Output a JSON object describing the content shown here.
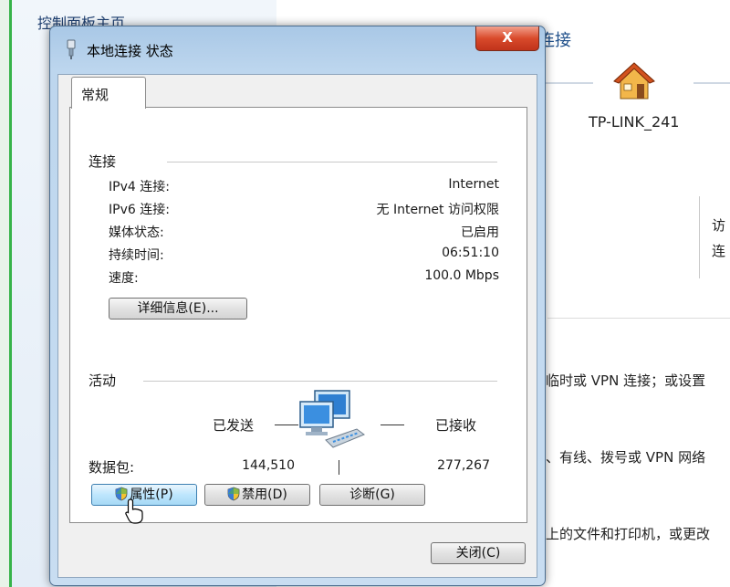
{
  "background": {
    "nav_title": "控制面板主页",
    "connection_title": "连接",
    "network_name": "TP-LINK_241",
    "access_labels": [
      "访",
      "连"
    ],
    "text_lines": [
      "临时或 VPN 连接；或设置",
      "、有线、拨号或 VPN 网络",
      "上的文件和打印机，或更改"
    ]
  },
  "dialog": {
    "title": "本地连接 状态",
    "close_label": "X",
    "tab_label": "常规",
    "connection": {
      "heading": "连接",
      "rows": [
        {
          "label": "IPv4 连接:",
          "value": "Internet"
        },
        {
          "label": "IPv6 连接:",
          "value": "无 Internet 访问权限"
        },
        {
          "label": "媒体状态:",
          "value": "已启用"
        },
        {
          "label": "持续时间:",
          "value": "06:51:10"
        },
        {
          "label": "速度:",
          "value": "100.0 Mbps"
        }
      ],
      "details_button": "详细信息(E)..."
    },
    "activity": {
      "heading": "活动",
      "sent_label": "已发送",
      "received_label": "已接收",
      "packets_label": "数据包:",
      "packets_sent": "144,510",
      "packets_received": "277,267"
    },
    "buttons": {
      "properties": "属性(P)",
      "disable": "禁用(D)",
      "diagnose": "诊断(G)",
      "close": "关闭(C)"
    }
  },
  "colors": {
    "titlebar": "#bdd6ee",
    "close_red": "#d94a2b",
    "house_roof": "#d2521e",
    "house_wall": "#f2b64a"
  },
  "icons": [
    "network-adapter-icon",
    "house-icon",
    "network-computers-icon",
    "shield-icon",
    "mouse-cursor-icon"
  ]
}
